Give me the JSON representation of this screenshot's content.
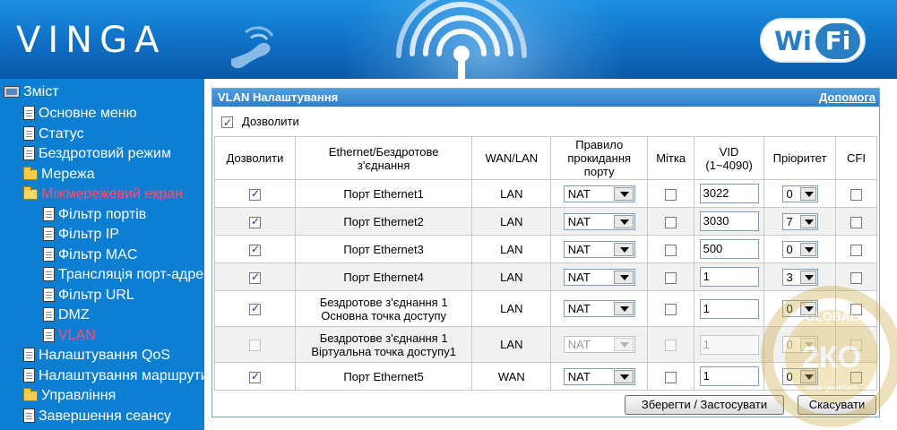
{
  "header": {
    "logo": "VINGA",
    "badge_left": "Wi",
    "badge_right": "Fi"
  },
  "sidebar": {
    "root": "Зміст",
    "items": [
      {
        "label": "Основне меню",
        "icon": "document-icon"
      },
      {
        "label": "Статус",
        "icon": "document-icon"
      },
      {
        "label": "Бездротовий режим",
        "icon": "document-icon"
      },
      {
        "label": "Мережа",
        "icon": "folder-icon"
      },
      {
        "label": "Міжмережевий екран",
        "icon": "folder-open-icon"
      },
      {
        "label": "Фільтр портів",
        "icon": "document-icon"
      },
      {
        "label": "Фільтр IP",
        "icon": "document-icon"
      },
      {
        "label": "Фільтр MAC",
        "icon": "document-icon"
      },
      {
        "label": "Трансляція порт-адрес",
        "icon": "document-icon"
      },
      {
        "label": "Фільтр URL",
        "icon": "document-icon"
      },
      {
        "label": "DMZ",
        "icon": "document-icon"
      },
      {
        "label": "VLAN",
        "icon": "document-icon"
      },
      {
        "label": "Налаштування QoS",
        "icon": "document-icon"
      },
      {
        "label": "Налаштування маршрутизації",
        "icon": "document-icon"
      },
      {
        "label": "Управління",
        "icon": "folder-icon"
      },
      {
        "label": "Завершення сеансу",
        "icon": "document-icon"
      }
    ]
  },
  "panel": {
    "title": "VLAN Налаштування",
    "help": "Допомога",
    "enable_label": "Дозволити",
    "enable_checked": true
  },
  "table": {
    "headers": {
      "enable": "Дозволити",
      "iface_line1": "Ethernet/Бездротове",
      "iface_line2": "з'єднання",
      "wanlan": "WAN/LAN",
      "rule_line1": "Правило",
      "rule_line2": "прокидання",
      "rule_line3": "порту",
      "tag": "Мітка",
      "vid_line1": "VID",
      "vid_line2": "(1~4090)",
      "priority": "Пріоритет",
      "cfi": "CFI"
    },
    "rows": [
      {
        "enabled": true,
        "iface": "Порт Ethernet1",
        "iface2": "",
        "wanlan": "LAN",
        "rule": "NAT",
        "tag": false,
        "vid": "3022",
        "priority": "0",
        "cfi": false,
        "disabled": false
      },
      {
        "enabled": true,
        "iface": "Порт Ethernet2",
        "iface2": "",
        "wanlan": "LAN",
        "rule": "NAT",
        "tag": false,
        "vid": "3030",
        "priority": "7",
        "cfi": false,
        "disabled": false
      },
      {
        "enabled": true,
        "iface": "Порт Ethernet3",
        "iface2": "",
        "wanlan": "LAN",
        "rule": "NAT",
        "tag": false,
        "vid": "500",
        "priority": "0",
        "cfi": false,
        "disabled": false
      },
      {
        "enabled": true,
        "iface": "Порт Ethernet4",
        "iface2": "",
        "wanlan": "LAN",
        "rule": "NAT",
        "tag": false,
        "vid": "1",
        "priority": "3",
        "cfi": false,
        "disabled": false
      },
      {
        "enabled": true,
        "iface": "Бездротове з'єднання 1",
        "iface2": "Основна точка доступу",
        "wanlan": "LAN",
        "rule": "NAT",
        "tag": false,
        "vid": "1",
        "priority": "0",
        "cfi": false,
        "disabled": false
      },
      {
        "enabled": false,
        "iface": "Бездротове з'єднання 1",
        "iface2": "Віртуальна точка доступу1",
        "wanlan": "LAN",
        "rule": "NAT",
        "tag": false,
        "vid": "1",
        "priority": "0",
        "cfi": false,
        "disabled": true
      },
      {
        "enabled": true,
        "iface": "Порт Ethernet5",
        "iface2": "",
        "wanlan": "WAN",
        "rule": "NAT",
        "tag": false,
        "vid": "1",
        "priority": "0",
        "cfi": false,
        "disabled": false
      }
    ]
  },
  "buttons": {
    "save": "Зберегти / Застосувати",
    "cancel": "Скасувати"
  },
  "watermark": {
    "text_top": "GLOBAL",
    "text_mid": "2КО",
    "site": "www.geekhom"
  }
}
